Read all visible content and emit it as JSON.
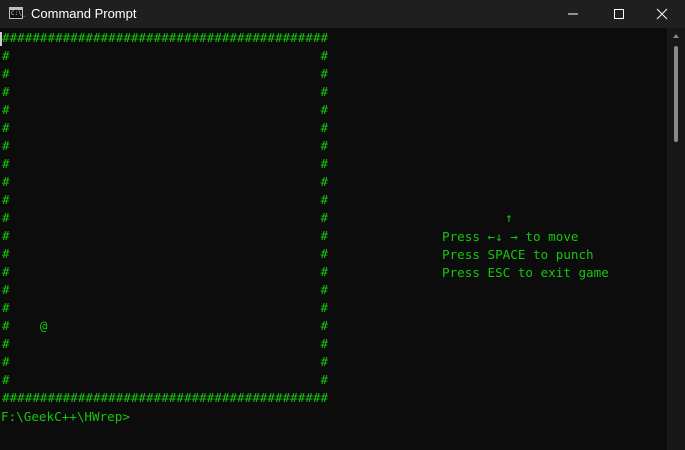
{
  "window": {
    "title": "Command Prompt",
    "icon": "console-app-icon",
    "icon_text": "C:\\_"
  },
  "controls": {
    "minimize": "minimize-icon",
    "maximize": "maximize-icon",
    "close": "close-icon"
  },
  "game": {
    "top_border": "###########################################",
    "bottom_border": "###########################################",
    "rows": [
      "#                                         #",
      "#                                         #",
      "#                                         #",
      "#                                         #",
      "#                                         #",
      "#                                         #",
      "#                                         #",
      "#                                         #",
      "#                                         #",
      "#                                         #",
      "#                                         #",
      "#                                         #",
      "#                                         #",
      "#                                         #",
      "#                                         #",
      "#    @                                    #",
      "#                                         #",
      "#                                         #",
      "#                                         #"
    ],
    "player_symbol": "@"
  },
  "instructions": {
    "arrow_up": "↑",
    "move": "Press ←↓ → to move",
    "punch": "Press SPACE to punch",
    "exit": "Press ESC to exit game"
  },
  "prompt": "F:\\GeekC++\\HWrep>",
  "colors": {
    "text": "#16c60c",
    "background": "#0c0c0c",
    "titlebar": "#1f1f1f"
  }
}
